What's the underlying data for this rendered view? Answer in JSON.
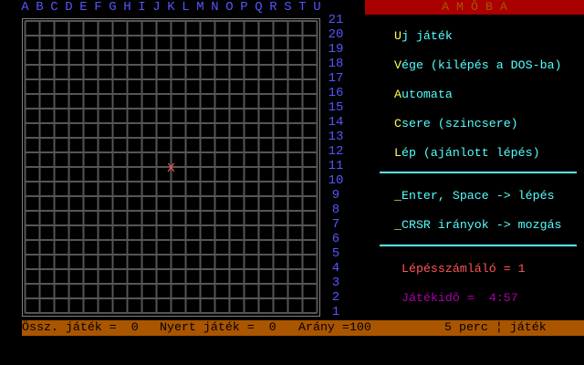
{
  "app_title": "A M Ô B A",
  "board": {
    "columns": [
      "A",
      "B",
      "C",
      "D",
      "E",
      "F",
      "G",
      "H",
      "I",
      "J",
      "K",
      "L",
      "M",
      "N",
      "O",
      "P",
      "Q",
      "R",
      "S",
      "T",
      "U"
    ],
    "rows": [
      "21",
      "20",
      "19",
      "18",
      "17",
      "16",
      "15",
      "14",
      "13",
      "12",
      "11",
      "10",
      "9",
      "8",
      "7",
      "6",
      "5",
      "4",
      "3",
      "2",
      "1"
    ],
    "pieces": [
      {
        "col": "K",
        "row": "11",
        "mark": "X"
      }
    ]
  },
  "menu": [
    {
      "hotkey": "U",
      "rest": "j játék"
    },
    {
      "hotkey": "V",
      "rest": "ége (kilépés a DOS-ba)"
    },
    {
      "hotkey": "A",
      "rest": "utomata"
    },
    {
      "hotkey": "C",
      "rest": "sere (szincsere)"
    },
    {
      "hotkey": "L",
      "rest": "ép (ajánlott lépés)"
    }
  ],
  "help": [
    {
      "prefix": "_",
      "text": "Enter, Space -> lépés"
    },
    {
      "prefix": "_",
      "text": "CRSR irányok -> mozgás"
    }
  ],
  "move_counter": "Lépésszámláló = 1",
  "game_time": "Játékidô =  4:57",
  "status": {
    "total_games": "Össz. játék =  0",
    "won_games": "Nyert játék =  0",
    "ratio": "Arány =100",
    "mode": "5 perc ¦ játék"
  },
  "colors": {
    "blue": "#5555ff",
    "yellow": "#ffff55",
    "cyan": "#55ffff",
    "red": "#ff5555",
    "magenta": "#aa00aa",
    "brown": "#aa5500",
    "dark_red": "#aa0000",
    "grid": "#555555"
  }
}
